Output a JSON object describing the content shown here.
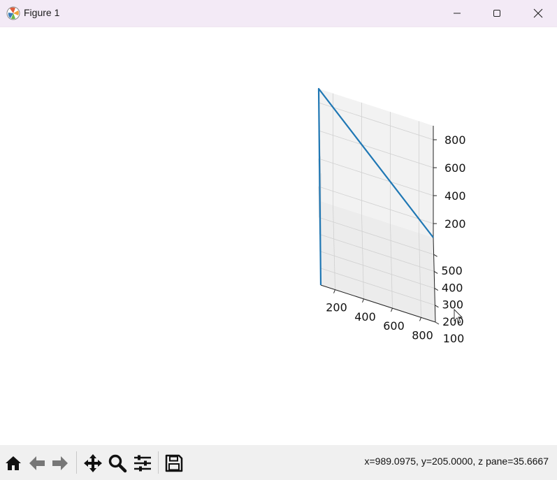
{
  "window": {
    "title": "Figure 1"
  },
  "toolbar": {
    "buttons": [
      "home-icon",
      "back-icon",
      "forward-icon",
      "pan-icon",
      "zoom-icon",
      "configure-subplots-icon",
      "save-icon"
    ],
    "status": "x=989.0975, y=205.0000, z pane=35.6667"
  },
  "colors": {
    "line": "#1f77b4",
    "pane": "#f2f2f2",
    "grid": "#d0d0d0",
    "titlebar": "#f3eaf6",
    "toolbar": "#f0f0f0"
  },
  "chart_data": {
    "type": "line",
    "projection": "3d",
    "series": [
      {
        "x": [
          100,
          100,
          900
        ],
        "y": [
          100,
          600,
          600
        ],
        "z": [
          100,
          900,
          100
        ]
      }
    ],
    "xlim": [
      100,
      900
    ],
    "ylim": [
      100,
      600
    ],
    "zlim": [
      100,
      900
    ],
    "x_ticks": [
      "200",
      "400",
      "600",
      "800"
    ],
    "y_ticks": [
      "100",
      "200",
      "300",
      "400",
      "500"
    ],
    "z_ticks": [
      "200",
      "400",
      "600",
      "800"
    ],
    "grid": true
  }
}
